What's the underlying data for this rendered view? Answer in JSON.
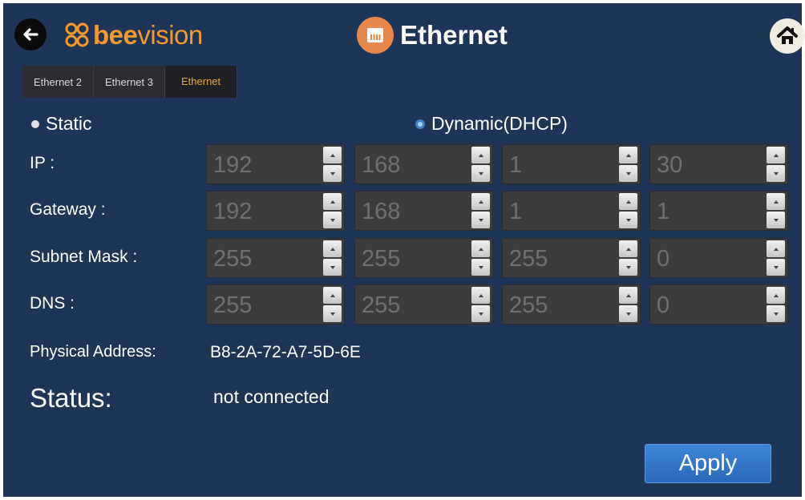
{
  "header": {
    "logo_text_bold": "bee",
    "logo_text_light": "vision",
    "title": "Ethernet"
  },
  "tabs": [
    {
      "label": "Ethernet 2",
      "active": false
    },
    {
      "label": "Ethernet 3",
      "active": false
    },
    {
      "label": "Ethernet",
      "active": true
    }
  ],
  "mode": {
    "static_label": "Static",
    "dhcp_label": "Dynamic(DHCP)",
    "selected": "Dynamic(DHCP)"
  },
  "fields": {
    "ip": {
      "label": "IP :",
      "values": [
        "192",
        "168",
        "1",
        "30"
      ]
    },
    "gateway": {
      "label": "Gateway :",
      "values": [
        "192",
        "168",
        "1",
        "1"
      ]
    },
    "subnet": {
      "label": "Subnet Mask :",
      "values": [
        "255",
        "255",
        "255",
        "0"
      ]
    },
    "dns": {
      "label": "DNS :",
      "values": [
        "255",
        "255",
        "255",
        "0"
      ]
    }
  },
  "physical": {
    "label": "Physical Address:",
    "value": "B8-2A-72-A7-5D-6E"
  },
  "status": {
    "label": "Status:",
    "value": "not connected"
  },
  "apply_label": "Apply",
  "colors": {
    "background": "#1e3557",
    "brand_orange": "#f29a2e",
    "active_tab": "#e6a53a",
    "apply_blue": "#2a69bb"
  },
  "icons": {
    "back": "back-arrow-icon",
    "logo": "beevision-logo-icon",
    "ethernet": "ethernet-port-icon",
    "home": "home-icon"
  }
}
